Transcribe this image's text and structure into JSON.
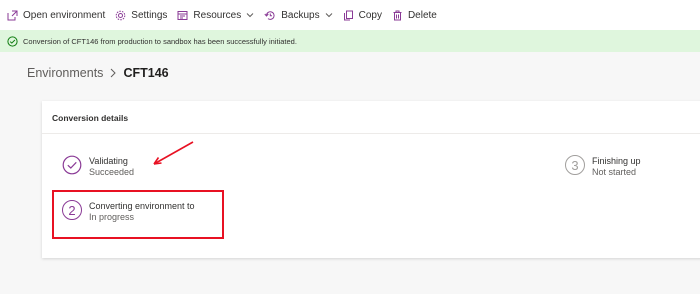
{
  "toolbar": {
    "open_environment": "Open environment",
    "settings": "Settings",
    "resources": "Resources",
    "backups": "Backups",
    "copy": "Copy",
    "delete": "Delete",
    "icon_color": "#8a3a96"
  },
  "banner": {
    "message": "Conversion of CFT146 from production to sandbox has been successfully initiated.",
    "color": "#dff6dd",
    "icon": "check-circle-icon"
  },
  "breadcrumb": {
    "parent": "Environments",
    "current": "CFT146"
  },
  "card": {
    "title": "Conversion details",
    "steps": [
      {
        "number": "",
        "name": "Validating",
        "status": "Succeeded",
        "icon": "check-circle-icon"
      },
      {
        "number": "2",
        "name": "Converting environment to",
        "status": "In progress"
      },
      {
        "number": "3",
        "name": "Finishing up",
        "status": "Not started"
      }
    ]
  },
  "annotations": {
    "color": "#e81123"
  }
}
